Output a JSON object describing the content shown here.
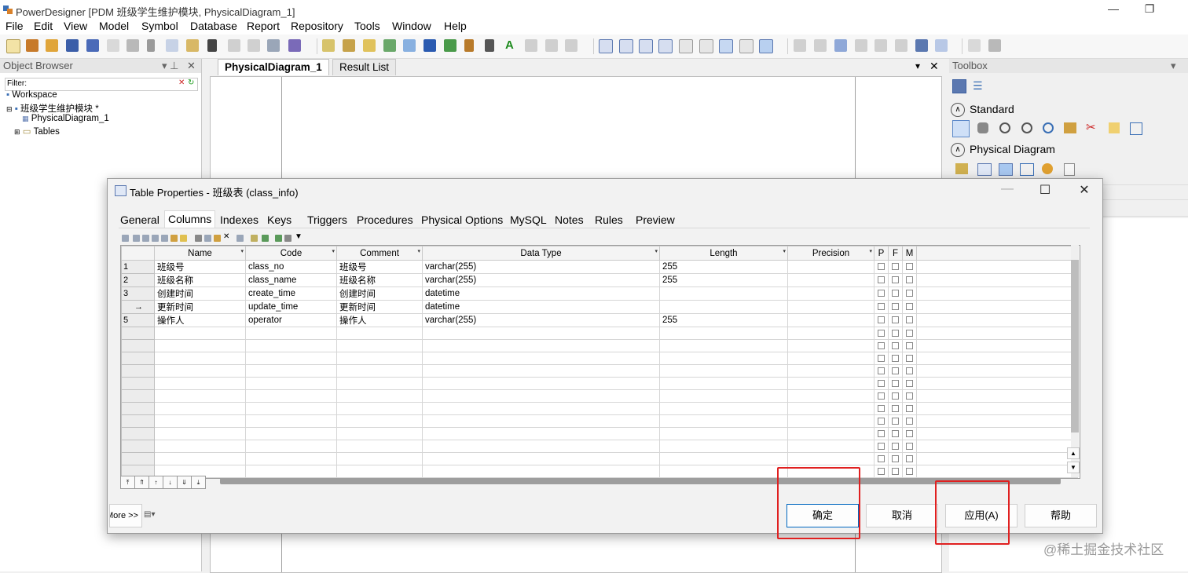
{
  "window": {
    "title": "PowerDesigner [PDM 班级学生维护模块, PhysicalDiagram_1]",
    "minimize": "—",
    "restore": "❐"
  },
  "menu": [
    "File",
    "Edit",
    "View",
    "Model",
    "Symbol",
    "Database",
    "Report",
    "Repository",
    "Tools",
    "Window",
    "Help"
  ],
  "object_browser": {
    "title": "Object Browser",
    "filter_label": "Filter:",
    "tree": [
      {
        "label": "Workspace",
        "icon": "workspace-icon"
      },
      {
        "label": "班级学生维护模块 *",
        "icon": "model-icon"
      },
      {
        "label": "PhysicalDiagram_1",
        "icon": "diagram-icon"
      },
      {
        "label": "Tables",
        "icon": "folder-icon"
      }
    ]
  },
  "doc_tabs": [
    "PhysicalDiagram_1",
    "Result List"
  ],
  "toolbox": {
    "title": "Toolbox",
    "sections": [
      "Standard",
      "Physical Diagram"
    ]
  },
  "dialog": {
    "title": "Table Properties - 班级表 (class_info)",
    "tabs": [
      "General",
      "Columns",
      "Indexes",
      "Keys",
      "Triggers",
      "Procedures",
      "Physical Options",
      "MySQL",
      "Notes",
      "Rules",
      "Preview"
    ],
    "active_tab": "Columns",
    "columns": [
      "Name",
      "Code",
      "Comment",
      "Data Type",
      "Length",
      "Precision",
      "P",
      "F",
      "M"
    ],
    "rows": [
      {
        "marker": "1",
        "name": "班级号",
        "code": "class_no",
        "comment": "班级号",
        "data_type": "varchar(255)",
        "length": "255",
        "precision": ""
      },
      {
        "marker": "2",
        "name": "班级名称",
        "code": "class_name",
        "comment": "班级名称",
        "data_type": "varchar(255)",
        "length": "255",
        "precision": ""
      },
      {
        "marker": "3",
        "name": "创建时间",
        "code": "create_time",
        "comment": "创建时间",
        "data_type": "datetime",
        "length": "",
        "precision": ""
      },
      {
        "marker": "→",
        "name": "更新时间",
        "code": "update_time",
        "comment": "更新时间",
        "data_type": "datetime",
        "length": "",
        "precision": ""
      },
      {
        "marker": "5",
        "name": "操作人",
        "code": "operator",
        "comment": "操作人",
        "data_type": "varchar(255)",
        "length": "255",
        "precision": ""
      }
    ],
    "empty_rows": 12,
    "more_button": "More >>",
    "buttons": {
      "ok": "确定",
      "cancel": "取消",
      "apply": "应用(A)",
      "help": "帮助"
    }
  },
  "watermark": "@稀土掘金技术社区",
  "colors": {
    "highlight_box": "#e02020",
    "default_button_border": "#0067c0"
  }
}
